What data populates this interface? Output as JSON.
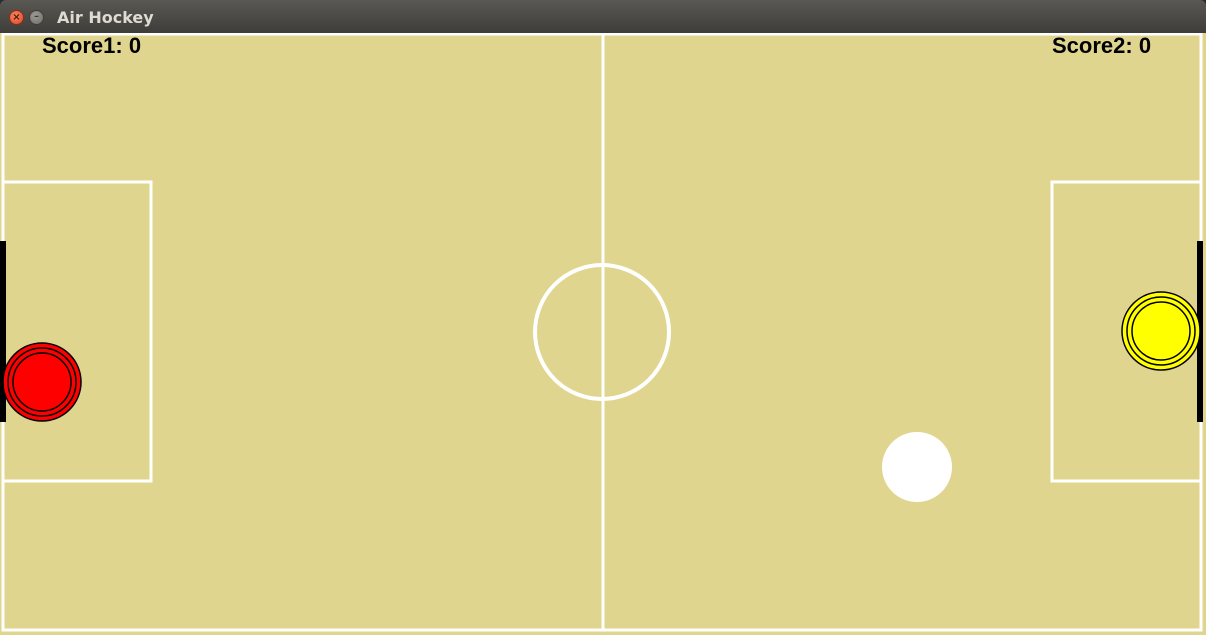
{
  "window": {
    "title": "Air Hockey",
    "close_icon": "close-icon",
    "minimize_icon": "minimize-icon"
  },
  "scoreboard": {
    "player1_label": "Score1: 0",
    "player2_label": "Score2: 0"
  },
  "colors": {
    "rink": "#e0d58f",
    "lines": "#ffffff",
    "player1_mallet": "#ff0000",
    "player2_mallet": "#ffff00",
    "puck": "#ffffff",
    "goal": "#000000"
  },
  "game": {
    "player1_score": 0,
    "player2_score": 0
  }
}
